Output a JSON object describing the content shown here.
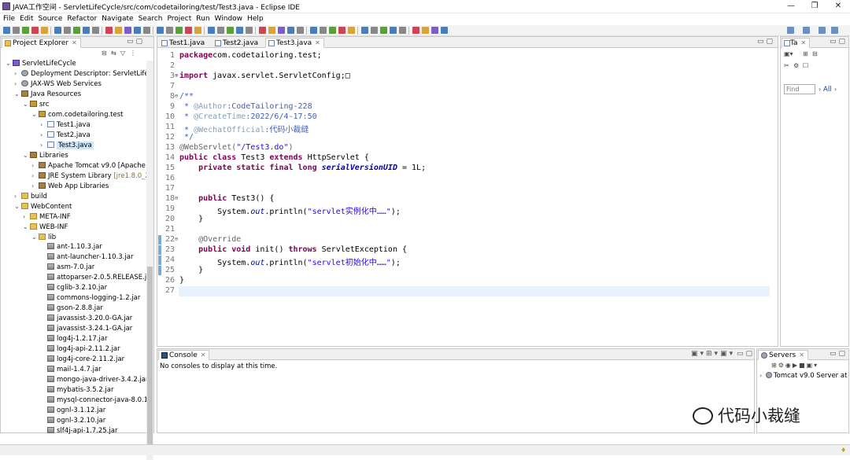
{
  "window": {
    "title": "JAVA工作空间 - ServletLifeCycle/src/com/codetailoring/test/Test3.java - Eclipse IDE",
    "controls": [
      "—",
      "❐",
      "✕"
    ]
  },
  "menu": [
    "File",
    "Edit",
    "Source",
    "Refactor",
    "Navigate",
    "Search",
    "Project",
    "Run",
    "Window",
    "Help"
  ],
  "project_explorer": {
    "tab_label": "Project Explorer",
    "tree": [
      {
        "label": "ServletLifeCycle",
        "depth": 0,
        "twisty": "v",
        "icon": "proj"
      },
      {
        "label": "Deployment Descriptor: ServletLifec",
        "depth": 1,
        "twisty": ">",
        "icon": "gear"
      },
      {
        "label": "JAX-WS Web Services",
        "depth": 1,
        "twisty": ">",
        "icon": "gear"
      },
      {
        "label": "Java Resources",
        "depth": 1,
        "twisty": "v",
        "icon": "lib"
      },
      {
        "label": "src",
        "depth": 2,
        "twisty": "v",
        "icon": "pkg"
      },
      {
        "label": "com.codetailoring.test",
        "depth": 3,
        "twisty": "v",
        "icon": "pkg"
      },
      {
        "label": "Test1.java",
        "depth": 4,
        "twisty": ">",
        "icon": "java"
      },
      {
        "label": "Test2.java",
        "depth": 4,
        "twisty": ">",
        "icon": "java"
      },
      {
        "label": "Test3.java",
        "depth": 4,
        "twisty": ">",
        "icon": "java",
        "selected": true
      },
      {
        "label": "Libraries",
        "depth": 2,
        "twisty": "v",
        "icon": "lib"
      },
      {
        "label": "Apache Tomcat v9.0 [Apache T",
        "depth": 3,
        "twisty": ">",
        "icon": "lib"
      },
      {
        "label": "JRE System Library ",
        "decoration": "[jre1.8.0_25",
        "depth": 3,
        "twisty": ">",
        "icon": "lib"
      },
      {
        "label": "Web App Libraries",
        "depth": 3,
        "twisty": ">",
        "icon": "lib"
      },
      {
        "label": "build",
        "depth": 1,
        "twisty": ">",
        "icon": "folder"
      },
      {
        "label": "WebContent",
        "depth": 1,
        "twisty": "v",
        "icon": "folder"
      },
      {
        "label": "META-INF",
        "depth": 2,
        "twisty": ">",
        "icon": "folder"
      },
      {
        "label": "WEB-INF",
        "depth": 2,
        "twisty": "v",
        "icon": "folder"
      },
      {
        "label": "lib",
        "depth": 3,
        "twisty": "v",
        "icon": "folder"
      },
      {
        "label": "ant-1.10.3.jar",
        "depth": 4,
        "twisty": "",
        "icon": "jar"
      },
      {
        "label": "ant-launcher-1.10.3.jar",
        "depth": 4,
        "twisty": "",
        "icon": "jar"
      },
      {
        "label": "asm-7.0.jar",
        "depth": 4,
        "twisty": "",
        "icon": "jar"
      },
      {
        "label": "attoparser-2.0.5.RELEASE.ja",
        "depth": 4,
        "twisty": "",
        "icon": "jar"
      },
      {
        "label": "cglib-3.2.10.jar",
        "depth": 4,
        "twisty": "",
        "icon": "jar"
      },
      {
        "label": "commons-logging-1.2.jar",
        "depth": 4,
        "twisty": "",
        "icon": "jar"
      },
      {
        "label": "gson-2.8.8.jar",
        "depth": 4,
        "twisty": "",
        "icon": "jar"
      },
      {
        "label": "javassist-3.20.0-GA.jar",
        "depth": 4,
        "twisty": "",
        "icon": "jar"
      },
      {
        "label": "javassist-3.24.1-GA.jar",
        "depth": 4,
        "twisty": "",
        "icon": "jar"
      },
      {
        "label": "log4j-1.2.17.jar",
        "depth": 4,
        "twisty": "",
        "icon": "jar"
      },
      {
        "label": "log4j-api-2.11.2.jar",
        "depth": 4,
        "twisty": "",
        "icon": "jar"
      },
      {
        "label": "log4j-core-2.11.2.jar",
        "depth": 4,
        "twisty": "",
        "icon": "jar"
      },
      {
        "label": "mail-1.4.7.jar",
        "depth": 4,
        "twisty": "",
        "icon": "jar"
      },
      {
        "label": "mongo-java-driver-3.4.2.jar",
        "depth": 4,
        "twisty": "",
        "icon": "jar"
      },
      {
        "label": "mybatis-3.5.2.jar",
        "depth": 4,
        "twisty": "",
        "icon": "jar"
      },
      {
        "label": "mysql-connector-java-8.0.1",
        "depth": 4,
        "twisty": "",
        "icon": "jar"
      },
      {
        "label": "ognl-3.1.12.jar",
        "depth": 4,
        "twisty": "",
        "icon": "jar"
      },
      {
        "label": "ognl-3.2.10.jar",
        "depth": 4,
        "twisty": "",
        "icon": "jar"
      },
      {
        "label": "slf4j-api-1.7.25.jar",
        "depth": 4,
        "twisty": "",
        "icon": "jar"
      }
    ]
  },
  "editor": {
    "tabs": [
      {
        "label": "Test1.java",
        "active": false
      },
      {
        "label": "Test2.java",
        "active": false
      },
      {
        "label": "Test3.java",
        "active": true
      }
    ],
    "lines": [
      {
        "n": "1",
        "tokens": [
          [
            "kw",
            "package"
          ],
          [
            "",
            "com.codetailoring.test;"
          ]
        ]
      },
      {
        "n": "2",
        "tokens": []
      },
      {
        "n": "3",
        "fold": "+",
        "tokens": [
          [
            "kw",
            "import"
          ],
          [
            "",
            " javax.servlet.ServletConfig;"
          ],
          [
            "",
            "□"
          ]
        ]
      },
      {
        "n": "7",
        "tokens": []
      },
      {
        "n": "8",
        "fold": "-",
        "tokens": [
          [
            "cm",
            "/**"
          ]
        ]
      },
      {
        "n": "9",
        "tokens": [
          [
            "cm",
            " * "
          ],
          [
            "cmt",
            "@Author"
          ],
          [
            "cm",
            ":CodeTailoring-228"
          ]
        ]
      },
      {
        "n": "10",
        "tokens": [
          [
            "cm",
            " * "
          ],
          [
            "cmt",
            "@CreateTime"
          ],
          [
            "cm",
            ":2022/6/4-17:50"
          ]
        ]
      },
      {
        "n": "11",
        "tokens": [
          [
            "cm",
            " * "
          ],
          [
            "cmt",
            "@WechatOfficial"
          ],
          [
            "cm",
            ":代码小裁缝"
          ]
        ]
      },
      {
        "n": "12",
        "tokens": [
          [
            "cm",
            " */"
          ]
        ]
      },
      {
        "n": "13",
        "tokens": [
          [
            "an",
            "@WebServlet("
          ],
          [
            "str",
            "\"/Test3.do\""
          ],
          [
            "an",
            ")"
          ]
        ]
      },
      {
        "n": "14",
        "tokens": [
          [
            "kw",
            "public class"
          ],
          [
            "",
            " Test3 "
          ],
          [
            "kw",
            "extends"
          ],
          [
            "",
            " HttpServlet {"
          ]
        ]
      },
      {
        "n": "15",
        "tokens": [
          [
            "",
            "    "
          ],
          [
            "kw",
            "private static final long"
          ],
          [
            "",
            " "
          ],
          [
            "fld",
            "serialVersionUID"
          ],
          [
            "",
            " = 1L;"
          ]
        ]
      },
      {
        "n": "16",
        "tokens": []
      },
      {
        "n": "17",
        "tokens": []
      },
      {
        "n": "18",
        "fold": "-",
        "tokens": [
          [
            "",
            "    "
          ],
          [
            "kw",
            "public"
          ],
          [
            "",
            " Test3() {"
          ]
        ]
      },
      {
        "n": "19",
        "tokens": [
          [
            "",
            "        System."
          ],
          [
            "ital",
            "out"
          ],
          [
            "",
            ".println("
          ],
          [
            "str",
            "\"servlet实例化中……\""
          ],
          [
            "",
            ");"
          ]
        ]
      },
      {
        "n": "20",
        "tokens": [
          [
            "",
            "    }"
          ]
        ]
      },
      {
        "n": "21",
        "tokens": []
      },
      {
        "n": "22",
        "fold": "-",
        "marker": true,
        "tokens": [
          [
            "",
            "    "
          ],
          [
            "an",
            "@Override"
          ]
        ]
      },
      {
        "n": "23",
        "marker": true,
        "tokens": [
          [
            "",
            "    "
          ],
          [
            "kw",
            "public void"
          ],
          [
            "",
            " init() "
          ],
          [
            "kw",
            "throws"
          ],
          [
            "",
            " ServletException {"
          ]
        ]
      },
      {
        "n": "24",
        "marker": true,
        "tokens": [
          [
            "",
            "        System."
          ],
          [
            "ital",
            "out"
          ],
          [
            "",
            ".println("
          ],
          [
            "str",
            "\"servlet初始化中……\""
          ],
          [
            "",
            ");"
          ]
        ]
      },
      {
        "n": "25",
        "marker": true,
        "tokens": [
          [
            "",
            "    }"
          ]
        ]
      },
      {
        "n": "26",
        "tokens": [
          [
            "",
            "}"
          ]
        ]
      },
      {
        "n": "27",
        "current": true,
        "tokens": []
      }
    ]
  },
  "task_panel": {
    "tab_label": "Ta",
    "find_placeholder": "Find",
    "filter_label": "All"
  },
  "console": {
    "tab_label": "Console",
    "message": "No consoles to display at this time."
  },
  "servers": {
    "tab_label": "Servers",
    "items": [
      "Tomcat v9.0 Server at"
    ]
  },
  "watermark": {
    "text": "代码小裁缝"
  },
  "colors": {
    "keyword": "#7f0055",
    "comment": "#3f5fbf",
    "string": "#2a00ff",
    "annotation": "#646464",
    "selection": "#cce8ff"
  }
}
